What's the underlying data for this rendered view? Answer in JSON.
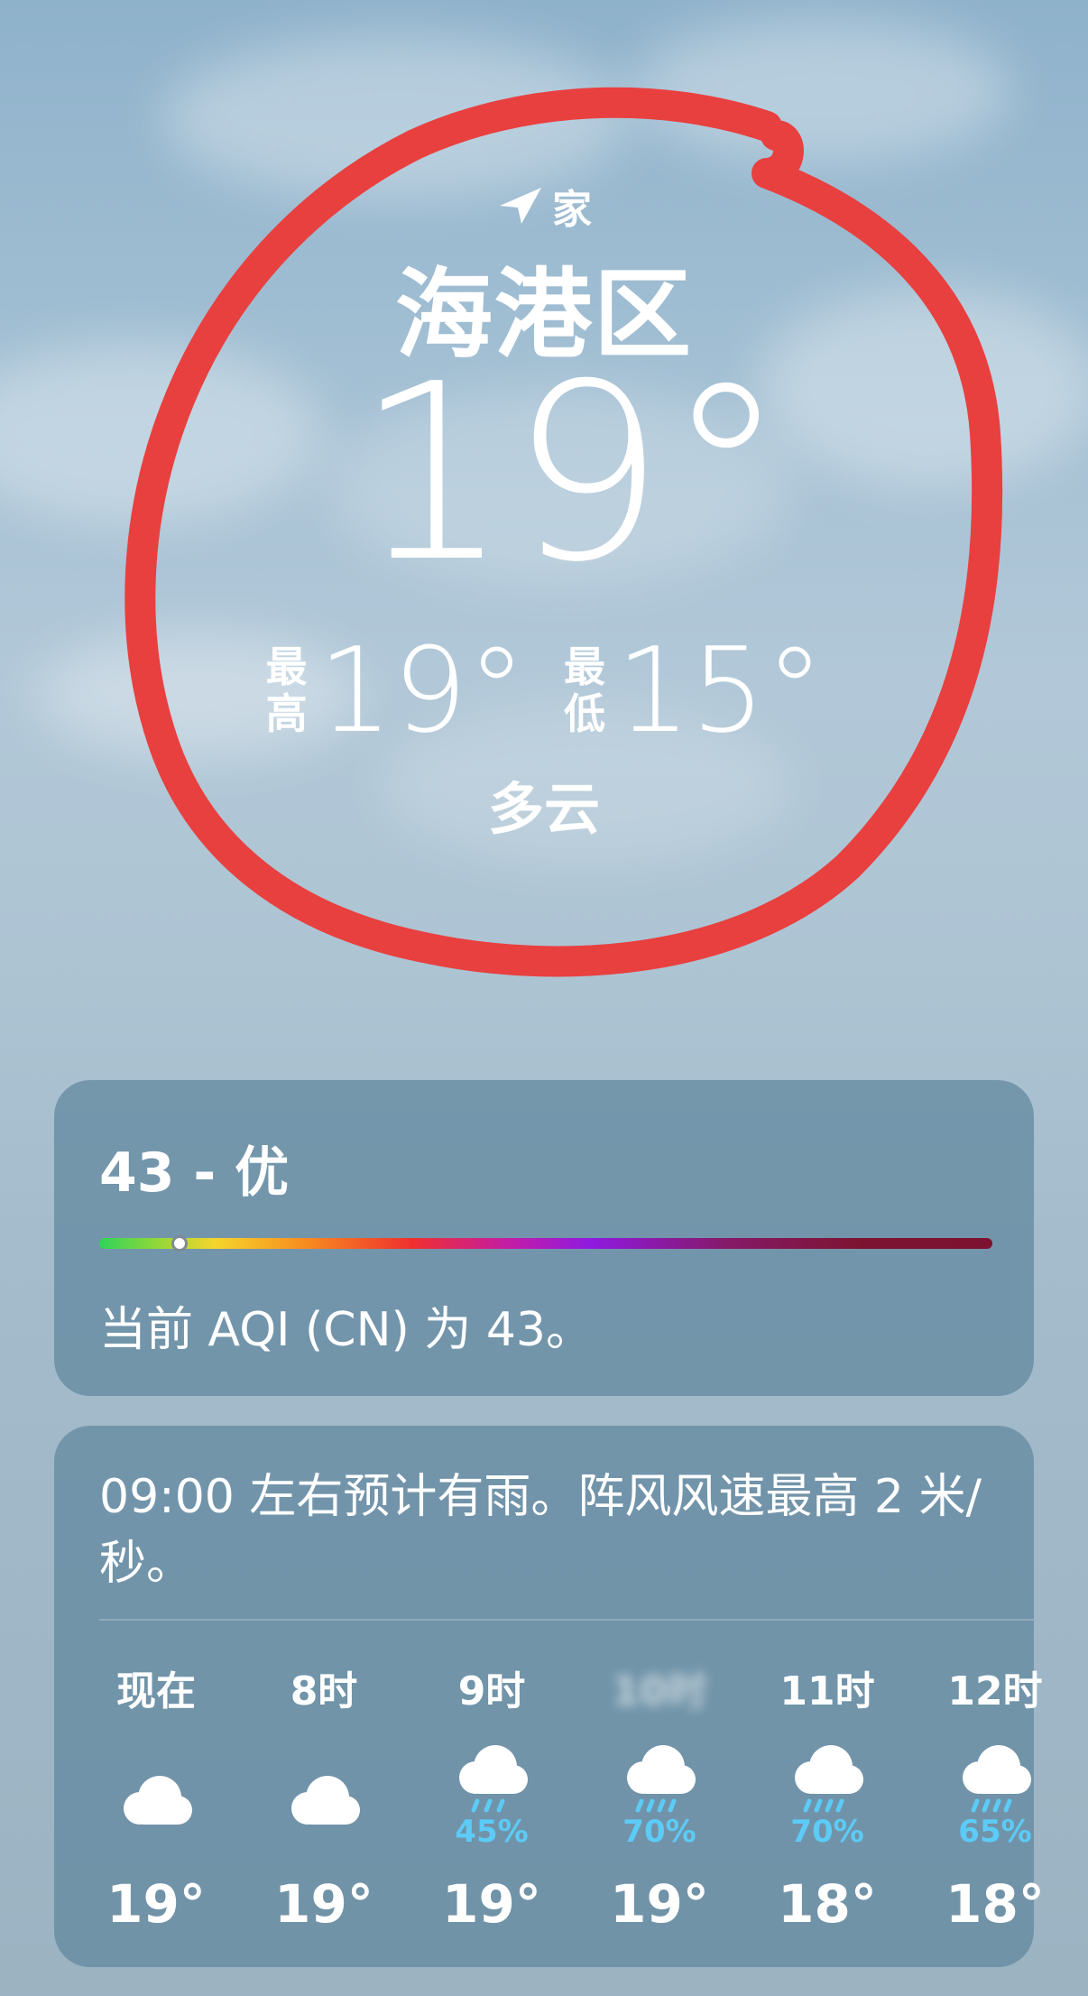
{
  "header": {
    "location_tag": "家",
    "city": "海港区",
    "current_temp": "19°",
    "high_label": "最高",
    "high_temp": "19°",
    "low_label": "最低",
    "low_temp": "15°",
    "condition": "多云"
  },
  "aqi": {
    "title": "43 - 优",
    "description": "当前 AQI (CN) 为 43。",
    "value": 43,
    "marker_fraction": 0.09
  },
  "forecast": {
    "summary": "09:00 左右预计有雨。阵风风速最高 2 米/秒。",
    "hours": [
      {
        "label": "现在",
        "icon": "cloud-icon",
        "prob": "",
        "temp": "19°"
      },
      {
        "label": "8时",
        "icon": "cloud-icon",
        "prob": "",
        "temp": "19°"
      },
      {
        "label": "9时",
        "icon": "rain-cloud-icon",
        "prob": "45%",
        "temp": "19°"
      },
      {
        "label": "",
        "icon": "rain-cloud-icon",
        "prob": "70%",
        "temp": "19°"
      },
      {
        "label": "11时",
        "icon": "rain-cloud-icon",
        "prob": "70%",
        "temp": "18°"
      },
      {
        "label": "12时",
        "icon": "rain-cloud-icon",
        "prob": "65%",
        "temp": "18°"
      }
    ]
  },
  "colors": {
    "annotation": "#e8403f",
    "precip": "#5ccbf6"
  }
}
